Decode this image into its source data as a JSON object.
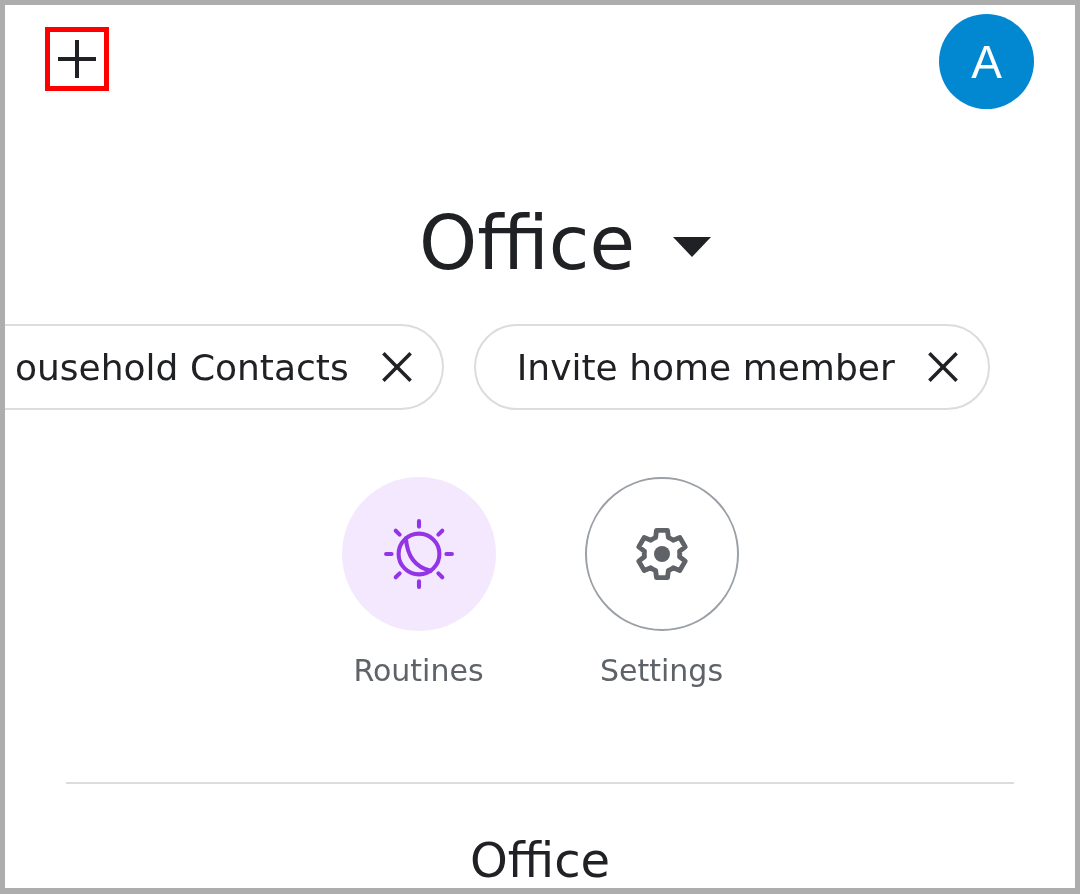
{
  "add_button": {
    "highlighted": true
  },
  "avatar": {
    "initial": "A"
  },
  "home_selector": {
    "name": "Office"
  },
  "chips": [
    {
      "label": "ousehold Contacts"
    },
    {
      "label": "Invite home member"
    }
  ],
  "actions": [
    {
      "kind": "routines",
      "label": "Routines"
    },
    {
      "kind": "settings",
      "label": "Settings"
    }
  ],
  "section": {
    "title": "Office"
  }
}
